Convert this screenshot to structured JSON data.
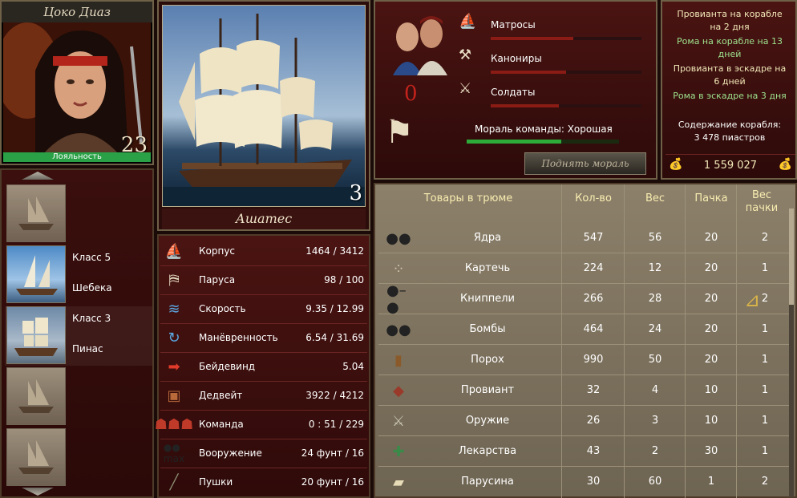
{
  "captain": {
    "name": "Цоко Диаз",
    "level": "23",
    "loyalty_label": "Лояльность"
  },
  "ships": [
    {
      "class": "",
      "type": ""
    },
    {
      "class": "Класс 5",
      "type": "Шебека"
    },
    {
      "class": "Класс 3",
      "type": "Пинас"
    },
    {
      "class": "",
      "type": ""
    },
    {
      "class": "",
      "type": ""
    }
  ],
  "ship": {
    "name": "Ашатес",
    "number": "3"
  },
  "stats": [
    {
      "icon": "hull-icon",
      "label": "Корпус",
      "value": "1464 / 3412"
    },
    {
      "icon": "sails-icon",
      "label": "Паруса",
      "value": "98 / 100"
    },
    {
      "icon": "speed-icon",
      "label": "Скорость",
      "value": "9.35 / 12.99"
    },
    {
      "icon": "maneuver-icon",
      "label": "Манёвренность",
      "value": "6.54 / 31.69"
    },
    {
      "icon": "windward-icon",
      "label": "Бейдевинд",
      "value": "5.04"
    },
    {
      "icon": "deadweight-icon",
      "label": "Дедвейт",
      "value": "3922 / 4212"
    },
    {
      "icon": "crew-icon",
      "label": "Команда",
      "value": "0 : 51 / 229"
    },
    {
      "icon": "armament-icon",
      "label": "Вооружение",
      "value": "24 фунт / 16"
    },
    {
      "icon": "cannon-icon",
      "label": "Пушки",
      "value": "20 фунт / 16"
    }
  ],
  "crew": {
    "count": "0",
    "roles": [
      {
        "icon": "sailor-icon",
        "label": "Матросы",
        "level": 0.55
      },
      {
        "icon": "gunner-icon",
        "label": "Канониры",
        "level": 0.5
      },
      {
        "icon": "soldier-icon",
        "label": "Солдаты",
        "level": 0.45
      }
    ],
    "morale_label": "Мораль команды: Хорошая",
    "morale_level": 0.62,
    "raise_morale": "Поднять мораль"
  },
  "supplies": {
    "line1": "Провианта на корабле",
    "line2": "на 2 дня",
    "line3": "Рома на корабле на 13",
    "line4": "дней",
    "line5": "Провианта в эскадре на",
    "line6": "6 дней",
    "line7": "Рома в эскадре на 3 дня",
    "line8": "Содержание корабля:",
    "line9": "3 478 пиастров",
    "money": "1 559 027"
  },
  "cargo": {
    "headers": {
      "goods": "Товары в трюме",
      "qty": "Кол-во",
      "weight": "Вес",
      "pack": "Пачка",
      "packweight": "Вес пачки"
    },
    "rows": [
      {
        "icon": "cannonballs-icon",
        "name": "Ядра",
        "qty": "547",
        "weight": "56",
        "pack": "20",
        "packweight": "2"
      },
      {
        "icon": "grapeshot-icon",
        "name": "Картечь",
        "qty": "224",
        "weight": "12",
        "pack": "20",
        "packweight": "1"
      },
      {
        "icon": "chainshot-icon",
        "name": "Книппели",
        "qty": "266",
        "weight": "28",
        "pack": "20",
        "packweight": "2"
      },
      {
        "icon": "bombs-icon",
        "name": "Бомбы",
        "qty": "464",
        "weight": "24",
        "pack": "20",
        "packweight": "1"
      },
      {
        "icon": "gunpowder-icon",
        "name": "Порох",
        "qty": "990",
        "weight": "50",
        "pack": "20",
        "packweight": "1"
      },
      {
        "icon": "provisions-icon",
        "name": "Провиант",
        "qty": "32",
        "weight": "4",
        "pack": "10",
        "packweight": "1"
      },
      {
        "icon": "weapons-icon",
        "name": "Оружие",
        "qty": "26",
        "weight": "3",
        "pack": "10",
        "packweight": "1"
      },
      {
        "icon": "medicine-icon",
        "name": "Лекарства",
        "qty": "43",
        "weight": "2",
        "pack": "30",
        "packweight": "1"
      },
      {
        "icon": "sailcloth-icon",
        "name": "Парусина",
        "qty": "30",
        "weight": "60",
        "pack": "1",
        "packweight": "2"
      }
    ]
  },
  "colors": {
    "accent": "#f7ecb0",
    "morale": "#2eaa3a",
    "crew_bar": "#8b1b15",
    "loyalty": "#2aa147",
    "crew_zero": "#c3231c"
  }
}
